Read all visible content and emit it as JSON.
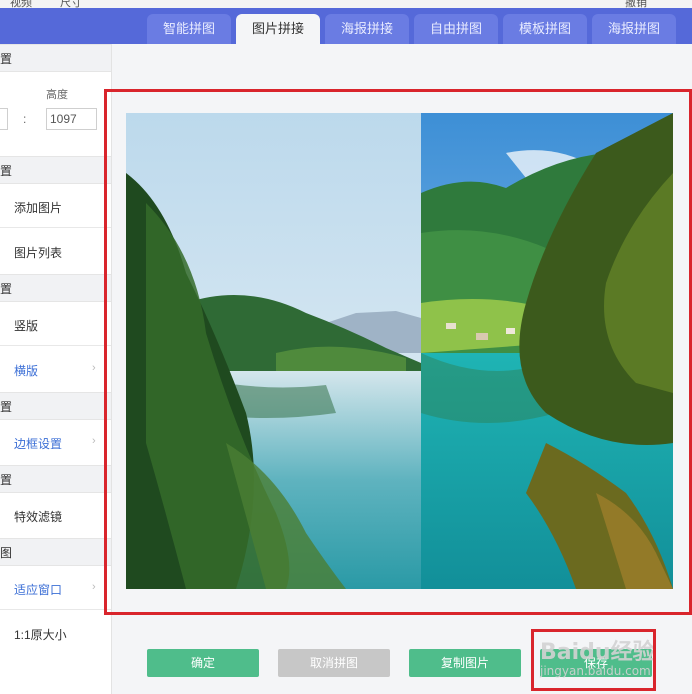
{
  "sysbar": {
    "left_label": "视频",
    "mid_label": "尺寸",
    "right_label": "撤销"
  },
  "tabs": [
    {
      "label": "智能拼图",
      "active": false
    },
    {
      "label": "图片拼接",
      "active": true
    },
    {
      "label": "海报拼接",
      "active": false
    },
    {
      "label": "自由拼图",
      "active": false
    },
    {
      "label": "模板拼图",
      "active": false
    },
    {
      "label": "海报拼图",
      "active": false
    }
  ],
  "left": {
    "sections": [
      "置",
      "置",
      "置",
      "置",
      "置",
      "图"
    ],
    "size": {
      "height_label": "高度",
      "height_value": "1097",
      "colon": ":"
    },
    "items": {
      "add_image": "添加图片",
      "image_list": "图片列表",
      "vertical": "竖版",
      "horizontal": "横版",
      "border": "边框设置",
      "filter": "特效滤镜",
      "fit_window": "适应窗口",
      "original_size": "1:1原大小"
    }
  },
  "buttons": {
    "confirm": "确定",
    "cancel_join": "取消拼图",
    "copy_image": "复制图片",
    "save": "保存"
  },
  "watermark": {
    "text": "Baidu经验",
    "sub": "jingyan.baidu.com"
  },
  "colors": {
    "tab_bar": "#5569d9",
    "green_button": "#4fbd8b",
    "highlight_red": "#d9252c",
    "link_blue": "#3c6fd6"
  }
}
